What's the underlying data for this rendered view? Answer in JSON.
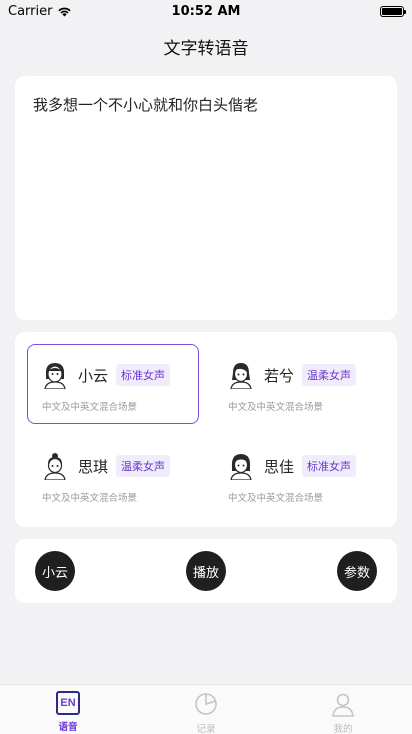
{
  "status_bar": {
    "carrier": "Carrier",
    "time": "10:52 AM"
  },
  "nav": {
    "title": "文字转语音"
  },
  "text_input": {
    "value": "我多想一个不小心就和你白头偕老"
  },
  "voices": [
    {
      "name": "小云",
      "tag": "标准女声",
      "desc": "中文及中英文混合场景",
      "selected": true
    },
    {
      "name": "若兮",
      "tag": "温柔女声",
      "desc": "中文及中英文混合场景",
      "selected": false
    },
    {
      "name": "思琪",
      "tag": "温柔女声",
      "desc": "中文及中英文混合场景",
      "selected": false
    },
    {
      "name": "思佳",
      "tag": "标准女声",
      "desc": "中文及中英文混合场景",
      "selected": false
    }
  ],
  "controls": {
    "voice_label": "小云",
    "play_label": "播放",
    "params_label": "参数"
  },
  "tabs": [
    {
      "label": "语音",
      "icon": "en-icon",
      "active": true
    },
    {
      "label": "记录",
      "icon": "pie-chart-icon",
      "active": false
    },
    {
      "label": "我的",
      "icon": "user-icon",
      "active": false
    }
  ],
  "colors": {
    "accent": "#6a3ad0",
    "selected_border": "#7c4dde",
    "tag_bg": "#f1ecfb",
    "button_bg": "#1f1f1f"
  }
}
